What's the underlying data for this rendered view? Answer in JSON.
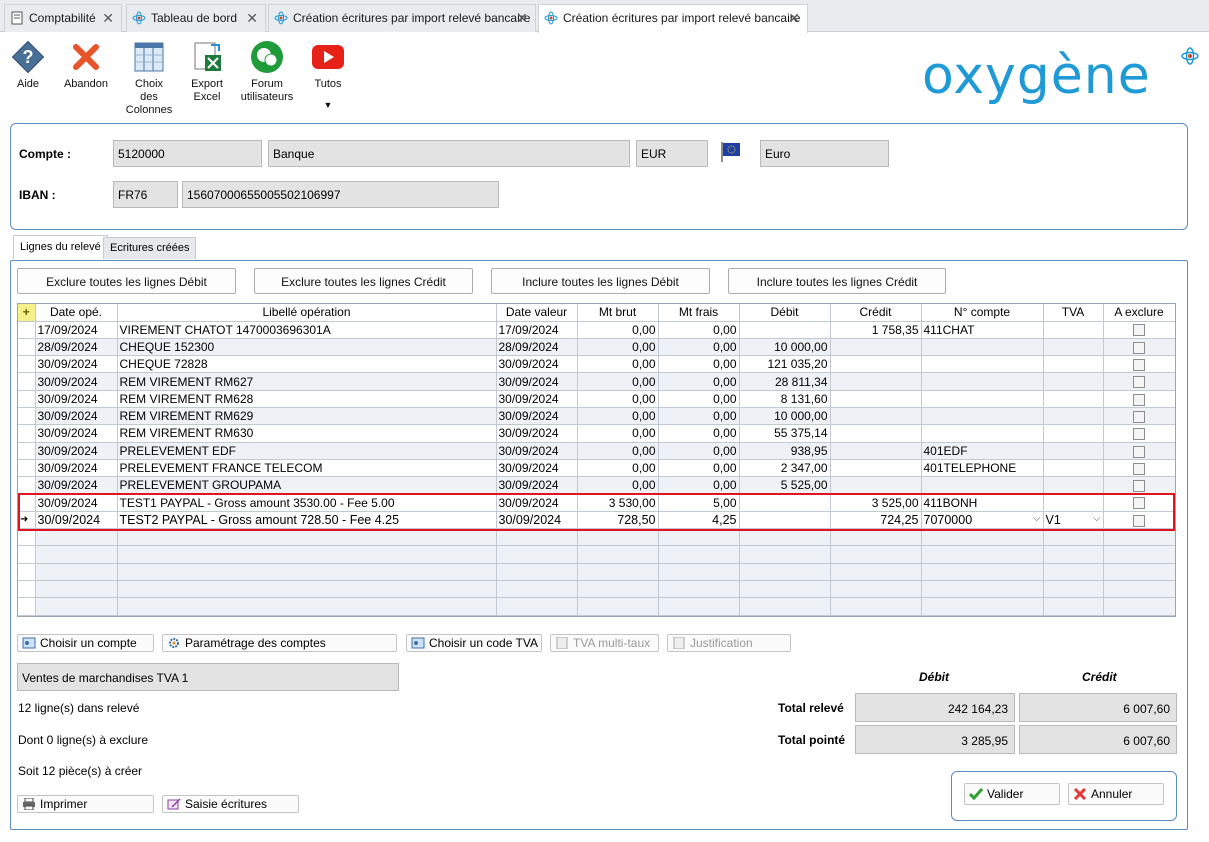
{
  "tabs": [
    {
      "label": "Comptabilité",
      "active": false
    },
    {
      "label": "Tableau de bord",
      "active": false
    },
    {
      "label": "Création écritures par import relevé bancaire",
      "active": false
    },
    {
      "label": "Création écritures par import relevé bancaire",
      "active": true
    }
  ],
  "toolbar": {
    "aide": "Aide",
    "abandon": "Abandon",
    "choix": [
      "Choix",
      "des",
      "Colonnes"
    ],
    "export": [
      "Export",
      "Excel"
    ],
    "forum": [
      "Forum",
      "utilisateurs"
    ],
    "tutos": "Tutos"
  },
  "logo": "oxygène",
  "account": {
    "compte_label": "Compte :",
    "compte_num": "5120000",
    "compte_name": "Banque",
    "currency_code": "EUR",
    "currency_name": "Euro",
    "iban_label": "IBAN :",
    "iban_prefix": "FR76",
    "iban_rest": "15607000655005502106997"
  },
  "inner_tabs": [
    "Lignes du relevé",
    "Ecritures créées"
  ],
  "actions": {
    "exclure_debit": "Exclure toutes les lignes Débit",
    "exclure_credit": "Exclure toutes les lignes Crédit",
    "inclure_debit": "Inclure toutes les lignes Débit",
    "inclure_credit": "Inclure toutes les lignes Crédit"
  },
  "grid": {
    "columns": [
      "Date opé.",
      "Libellé opération",
      "Date valeur",
      "Mt brut",
      "Mt frais",
      "Débit",
      "Crédit",
      "N° compte",
      "TVA",
      "A exclure"
    ],
    "rows": [
      [
        "17/09/2024",
        "VIREMENT CHATOT 1470003696301A",
        "17/09/2024",
        "0,00",
        "0,00",
        "",
        "1 758,35",
        "411CHAT",
        ""
      ],
      [
        "28/09/2024",
        "CHEQUE 152300",
        "28/09/2024",
        "0,00",
        "0,00",
        "10 000,00",
        "",
        "",
        ""
      ],
      [
        "30/09/2024",
        "CHEQUE 72828",
        "30/09/2024",
        "0,00",
        "0,00",
        "121 035,20",
        "",
        "",
        ""
      ],
      [
        "30/09/2024",
        "REM VIREMENT RM627",
        "30/09/2024",
        "0,00",
        "0,00",
        "28 811,34",
        "",
        "",
        ""
      ],
      [
        "30/09/2024",
        "REM VIREMENT RM628",
        "30/09/2024",
        "0,00",
        "0,00",
        "8 131,60",
        "",
        "",
        ""
      ],
      [
        "30/09/2024",
        "REM VIREMENT RM629",
        "30/09/2024",
        "0,00",
        "0,00",
        "10 000,00",
        "",
        "",
        ""
      ],
      [
        "30/09/2024",
        "REM VIREMENT RM630",
        "30/09/2024",
        "0,00",
        "0,00",
        "55 375,14",
        "",
        "",
        ""
      ],
      [
        "30/09/2024",
        "PRELEVEMENT EDF",
        "30/09/2024",
        "0,00",
        "0,00",
        "938,95",
        "",
        "401EDF",
        ""
      ],
      [
        "30/09/2024",
        "PRELEVEMENT FRANCE TELECOM",
        "30/09/2024",
        "0,00",
        "0,00",
        "2 347,00",
        "",
        "401TELEPHONE",
        ""
      ],
      [
        "30/09/2024",
        "PRELEVEMENT GROUPAMA",
        "30/09/2024",
        "0,00",
        "0,00",
        "5 525,00",
        "",
        "",
        ""
      ],
      [
        "30/09/2024",
        "TEST1 PAYPAL - Gross amount 3530.00 - Fee 5.00",
        "30/09/2024",
        "3 530,00",
        "5,00",
        "",
        "3 525,00",
        "411BONH",
        ""
      ],
      [
        "30/09/2024",
        "TEST2 PAYPAL - Gross amount 728.50 - Fee 4.25",
        "30/09/2024",
        "728,50",
        "4,25",
        "",
        "724,25",
        "7070000",
        "V1"
      ]
    ],
    "selected_row": 11,
    "empty_rows": 5
  },
  "bottom_buttons": {
    "choisir_compte": "Choisir un compte",
    "parametrage": "Paramétrage des comptes",
    "choisir_tva": "Choisir un code TVA",
    "tva_multi": "TVA multi-taux",
    "justification": "Justification"
  },
  "account_desc": "Ventes de marchandises TVA 1",
  "stats": {
    "lignes": "12 ligne(s) dans relevé",
    "exclure": "Dont 0 ligne(s) à exclure",
    "pieces": "Soit 12 pièce(s) à créer"
  },
  "totals": {
    "debit_header": "Débit",
    "credit_header": "Crédit",
    "releve_label": "Total relevé",
    "releve_debit": "242 164,23",
    "releve_credit": "6 007,60",
    "pointe_label": "Total pointé",
    "pointe_debit": "3 285,95",
    "pointe_credit": "6 007,60"
  },
  "footer": {
    "imprimer": "Imprimer",
    "saisie": "Saisie écritures",
    "valider": "Valider",
    "annuler": "Annuler"
  }
}
